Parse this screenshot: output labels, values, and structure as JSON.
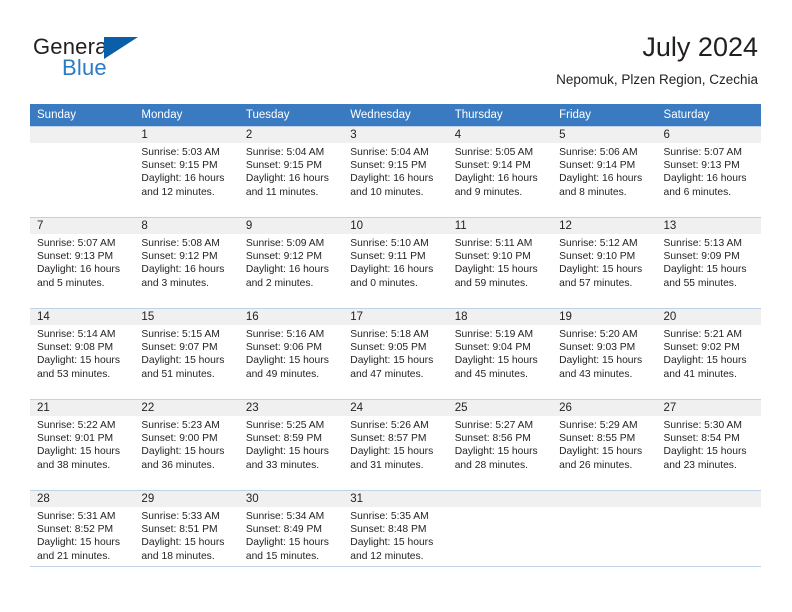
{
  "brand": {
    "name_part1": "General",
    "name_part2": "Blue",
    "accent_color": "#2b7cc4",
    "triangle_color": "#0a5fa8"
  },
  "header": {
    "title": "July 2024",
    "subtitle": "Nepomuk, Plzen Region, Czechia"
  },
  "calendar": {
    "header_bg": "#3a7ac0",
    "daynum_bg": "#f0f0f0",
    "grid_line": "#bfd2e8",
    "weekday_headers": [
      "Sunday",
      "Monday",
      "Tuesday",
      "Wednesday",
      "Thursday",
      "Friday",
      "Saturday"
    ],
    "weeks": [
      [
        {
          "day": "",
          "lines": []
        },
        {
          "day": "1",
          "lines": [
            "Sunrise: 5:03 AM",
            "Sunset: 9:15 PM",
            "Daylight: 16 hours",
            "and 12 minutes."
          ]
        },
        {
          "day": "2",
          "lines": [
            "Sunrise: 5:04 AM",
            "Sunset: 9:15 PM",
            "Daylight: 16 hours",
            "and 11 minutes."
          ]
        },
        {
          "day": "3",
          "lines": [
            "Sunrise: 5:04 AM",
            "Sunset: 9:15 PM",
            "Daylight: 16 hours",
            "and 10 minutes."
          ]
        },
        {
          "day": "4",
          "lines": [
            "Sunrise: 5:05 AM",
            "Sunset: 9:14 PM",
            "Daylight: 16 hours",
            "and 9 minutes."
          ]
        },
        {
          "day": "5",
          "lines": [
            "Sunrise: 5:06 AM",
            "Sunset: 9:14 PM",
            "Daylight: 16 hours",
            "and 8 minutes."
          ]
        },
        {
          "day": "6",
          "lines": [
            "Sunrise: 5:07 AM",
            "Sunset: 9:13 PM",
            "Daylight: 16 hours",
            "and 6 minutes."
          ]
        }
      ],
      [
        {
          "day": "7",
          "lines": [
            "Sunrise: 5:07 AM",
            "Sunset: 9:13 PM",
            "Daylight: 16 hours",
            "and 5 minutes."
          ]
        },
        {
          "day": "8",
          "lines": [
            "Sunrise: 5:08 AM",
            "Sunset: 9:12 PM",
            "Daylight: 16 hours",
            "and 3 minutes."
          ]
        },
        {
          "day": "9",
          "lines": [
            "Sunrise: 5:09 AM",
            "Sunset: 9:12 PM",
            "Daylight: 16 hours",
            "and 2 minutes."
          ]
        },
        {
          "day": "10",
          "lines": [
            "Sunrise: 5:10 AM",
            "Sunset: 9:11 PM",
            "Daylight: 16 hours",
            "and 0 minutes."
          ]
        },
        {
          "day": "11",
          "lines": [
            "Sunrise: 5:11 AM",
            "Sunset: 9:10 PM",
            "Daylight: 15 hours",
            "and 59 minutes."
          ]
        },
        {
          "day": "12",
          "lines": [
            "Sunrise: 5:12 AM",
            "Sunset: 9:10 PM",
            "Daylight: 15 hours",
            "and 57 minutes."
          ]
        },
        {
          "day": "13",
          "lines": [
            "Sunrise: 5:13 AM",
            "Sunset: 9:09 PM",
            "Daylight: 15 hours",
            "and 55 minutes."
          ]
        }
      ],
      [
        {
          "day": "14",
          "lines": [
            "Sunrise: 5:14 AM",
            "Sunset: 9:08 PM",
            "Daylight: 15 hours",
            "and 53 minutes."
          ]
        },
        {
          "day": "15",
          "lines": [
            "Sunrise: 5:15 AM",
            "Sunset: 9:07 PM",
            "Daylight: 15 hours",
            "and 51 minutes."
          ]
        },
        {
          "day": "16",
          "lines": [
            "Sunrise: 5:16 AM",
            "Sunset: 9:06 PM",
            "Daylight: 15 hours",
            "and 49 minutes."
          ]
        },
        {
          "day": "17",
          "lines": [
            "Sunrise: 5:18 AM",
            "Sunset: 9:05 PM",
            "Daylight: 15 hours",
            "and 47 minutes."
          ]
        },
        {
          "day": "18",
          "lines": [
            "Sunrise: 5:19 AM",
            "Sunset: 9:04 PM",
            "Daylight: 15 hours",
            "and 45 minutes."
          ]
        },
        {
          "day": "19",
          "lines": [
            "Sunrise: 5:20 AM",
            "Sunset: 9:03 PM",
            "Daylight: 15 hours",
            "and 43 minutes."
          ]
        },
        {
          "day": "20",
          "lines": [
            "Sunrise: 5:21 AM",
            "Sunset: 9:02 PM",
            "Daylight: 15 hours",
            "and 41 minutes."
          ]
        }
      ],
      [
        {
          "day": "21",
          "lines": [
            "Sunrise: 5:22 AM",
            "Sunset: 9:01 PM",
            "Daylight: 15 hours",
            "and 38 minutes."
          ]
        },
        {
          "day": "22",
          "lines": [
            "Sunrise: 5:23 AM",
            "Sunset: 9:00 PM",
            "Daylight: 15 hours",
            "and 36 minutes."
          ]
        },
        {
          "day": "23",
          "lines": [
            "Sunrise: 5:25 AM",
            "Sunset: 8:59 PM",
            "Daylight: 15 hours",
            "and 33 minutes."
          ]
        },
        {
          "day": "24",
          "lines": [
            "Sunrise: 5:26 AM",
            "Sunset: 8:57 PM",
            "Daylight: 15 hours",
            "and 31 minutes."
          ]
        },
        {
          "day": "25",
          "lines": [
            "Sunrise: 5:27 AM",
            "Sunset: 8:56 PM",
            "Daylight: 15 hours",
            "and 28 minutes."
          ]
        },
        {
          "day": "26",
          "lines": [
            "Sunrise: 5:29 AM",
            "Sunset: 8:55 PM",
            "Daylight: 15 hours",
            "and 26 minutes."
          ]
        },
        {
          "day": "27",
          "lines": [
            "Sunrise: 5:30 AM",
            "Sunset: 8:54 PM",
            "Daylight: 15 hours",
            "and 23 minutes."
          ]
        }
      ],
      [
        {
          "day": "28",
          "lines": [
            "Sunrise: 5:31 AM",
            "Sunset: 8:52 PM",
            "Daylight: 15 hours",
            "and 21 minutes."
          ]
        },
        {
          "day": "29",
          "lines": [
            "Sunrise: 5:33 AM",
            "Sunset: 8:51 PM",
            "Daylight: 15 hours",
            "and 18 minutes."
          ]
        },
        {
          "day": "30",
          "lines": [
            "Sunrise: 5:34 AM",
            "Sunset: 8:49 PM",
            "Daylight: 15 hours",
            "and 15 minutes."
          ]
        },
        {
          "day": "31",
          "lines": [
            "Sunrise: 5:35 AM",
            "Sunset: 8:48 PM",
            "Daylight: 15 hours",
            "and 12 minutes."
          ]
        },
        {
          "day": "",
          "lines": []
        },
        {
          "day": "",
          "lines": []
        },
        {
          "day": "",
          "lines": []
        }
      ]
    ]
  }
}
